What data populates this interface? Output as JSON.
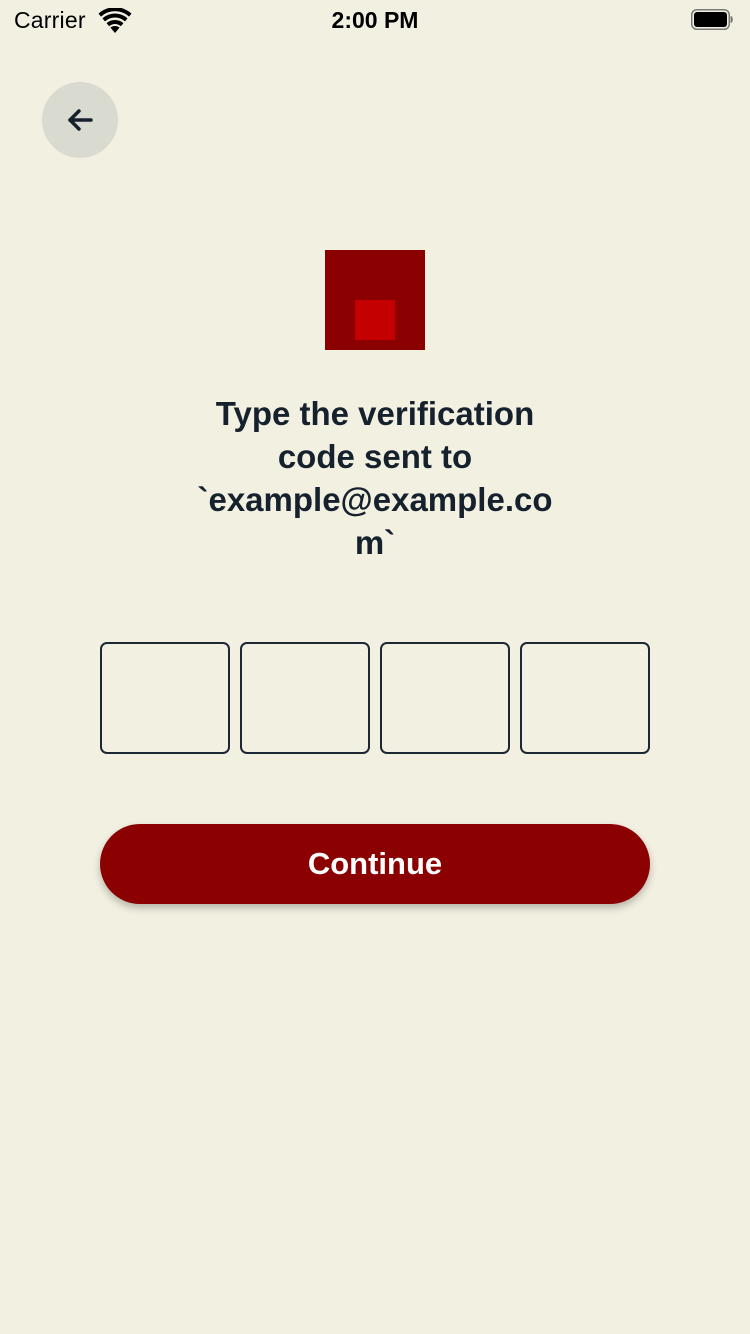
{
  "status_bar": {
    "carrier": "Carrier",
    "time": "2:00 PM",
    "wifi_icon": "wifi-icon",
    "battery_icon": "battery-icon"
  },
  "back_button": {
    "icon": "arrow-left-icon"
  },
  "logo": {
    "outer_color": "#8b0000",
    "inner_color": "#c40000"
  },
  "heading": {
    "line1": "Type the verification",
    "line2": "code sent to",
    "line3": "`example@example.co",
    "line4": "m`"
  },
  "code_inputs": [
    {
      "value": ""
    },
    {
      "value": ""
    },
    {
      "value": ""
    },
    {
      "value": ""
    }
  ],
  "continue_button": {
    "label": "Continue"
  },
  "colors": {
    "background": "#f2f0e1",
    "accent": "#8b0000",
    "text": "#16212e"
  }
}
